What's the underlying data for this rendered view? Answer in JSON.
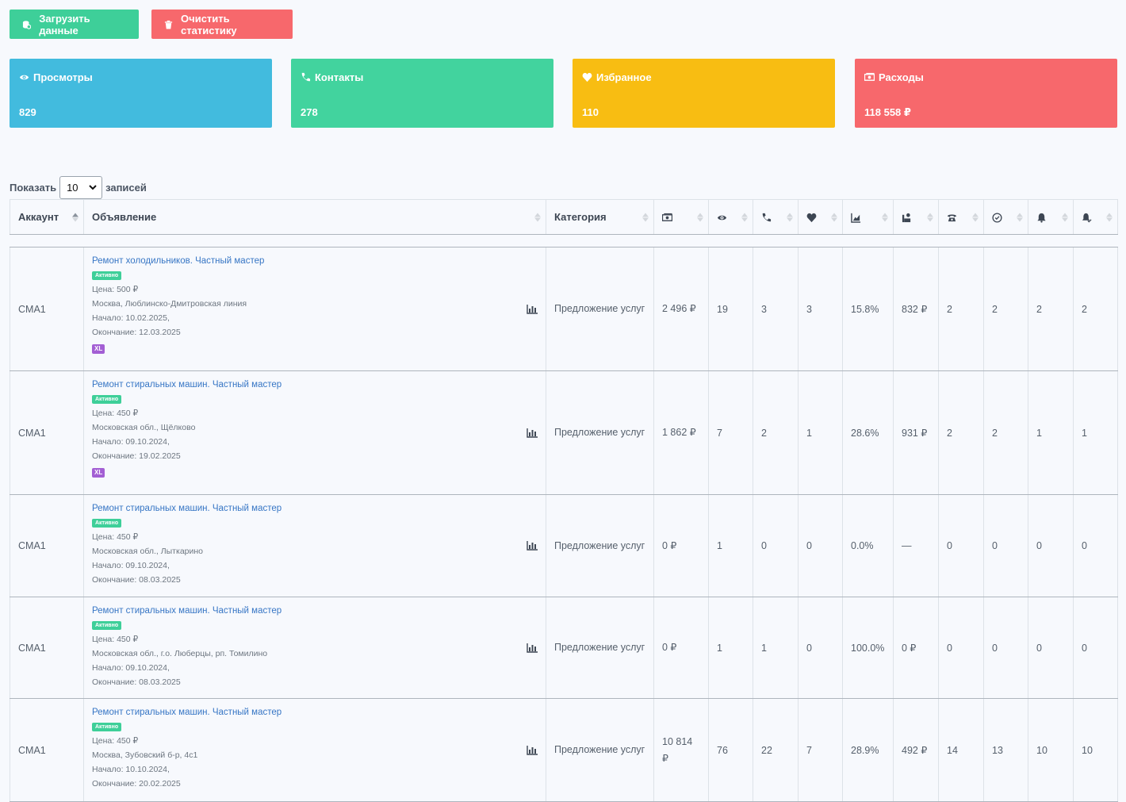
{
  "toolbar": {
    "load_label": "Загрузить данные",
    "clear_label": "Очистить статистику"
  },
  "cards": [
    {
      "title": "Просмотры",
      "value": "829",
      "icon": "eye-icon",
      "color": "#42bbde"
    },
    {
      "title": "Контакты",
      "value": "278",
      "icon": "phone-icon",
      "color": "#42d39e"
    },
    {
      "title": "Избранное",
      "value": "110",
      "icon": "heart-icon",
      "color": "#f8bd12"
    },
    {
      "title": "Расходы",
      "value": "118 558 ₽",
      "icon": "money-icon",
      "color": "#f7686c"
    }
  ],
  "length": {
    "show": "Показать",
    "value": "10",
    "records": "записей"
  },
  "table": {
    "headers": {
      "account": "Аккаунт",
      "ad": "Объявление",
      "category": "Категория"
    },
    "header_icons": [
      "money-icon",
      "eye-icon",
      "phone-icon",
      "heart-icon",
      "chart-area-icon",
      "user-money-icon",
      "telephone-icon",
      "check-circle-icon",
      "bell-icon",
      "bell-check-icon"
    ],
    "badge": "Активно",
    "xl": "XL",
    "rows": [
      {
        "account": "CMA1",
        "title": "Ремонт холодильников. Частный мастер",
        "price": "Цена: 500 ₽",
        "address": "Москва, Люблинско-Дмитровская линия",
        "start": "Начало: 10.02.2025,",
        "end": "Окончание: 12.03.2025",
        "has_xl": true,
        "category": "Предложение услуг",
        "cost": "2 496 ₽",
        "views": "19",
        "contacts": "3",
        "fav": "3",
        "conv": "15.8%",
        "cpc": "832 ₽",
        "calls": "2",
        "done": "2",
        "notif": "2",
        "notif2": "2"
      },
      {
        "account": "CMA1",
        "title": "Ремонт стиральных машин. Частный мастер",
        "price": "Цена: 450 ₽",
        "address": "Московская обл., Щёлково",
        "start": "Начало: 09.10.2024,",
        "end": "Окончание: 19.02.2025",
        "has_xl": true,
        "category": "Предложение услуг",
        "cost": "1 862 ₽",
        "views": "7",
        "contacts": "2",
        "fav": "1",
        "conv": "28.6%",
        "cpc": "931 ₽",
        "calls": "2",
        "done": "2",
        "notif": "1",
        "notif2": "1"
      },
      {
        "account": "CMA1",
        "title": "Ремонт стиральных машин. Частный мастер",
        "price": "Цена: 450 ₽",
        "address": "Московская обл., Лыткарино",
        "start": "Начало: 09.10.2024,",
        "end": "Окончание: 08.03.2025",
        "has_xl": false,
        "category": "Предложение услуг",
        "cost": "0 ₽",
        "views": "1",
        "contacts": "0",
        "fav": "0",
        "conv": "0.0%",
        "cpc": "—",
        "calls": "0",
        "done": "0",
        "notif": "0",
        "notif2": "0"
      },
      {
        "account": "CMA1",
        "title": "Ремонт стиральных машин. Частный мастер",
        "price": "Цена: 450 ₽",
        "address": "Московская обл., г.о. Люберцы, рп. Томилино",
        "start": "Начало: 09.10.2024,",
        "end": "Окончание: 08.03.2025",
        "has_xl": false,
        "category": "Предложение услуг",
        "cost": "0 ₽",
        "views": "1",
        "contacts": "1",
        "fav": "0",
        "conv": "100.0%",
        "cpc": "0 ₽",
        "calls": "0",
        "done": "0",
        "notif": "0",
        "notif2": "0"
      },
      {
        "account": "CMA1",
        "title": "Ремонт стиральных машин. Частный мастер",
        "price": "Цена: 450 ₽",
        "address": "Москва, Зубовский б-р, 4с1",
        "start": "Начало: 10.10.2024,",
        "end": "Окончание: 20.02.2025",
        "has_xl": false,
        "category": "Предложение услуг",
        "cost": "10 814 ₽",
        "views": "76",
        "contacts": "22",
        "fav": "7",
        "conv": "28.9%",
        "cpc": "492 ₽",
        "calls": "14",
        "done": "13",
        "notif": "10",
        "notif2": "10"
      }
    ]
  }
}
